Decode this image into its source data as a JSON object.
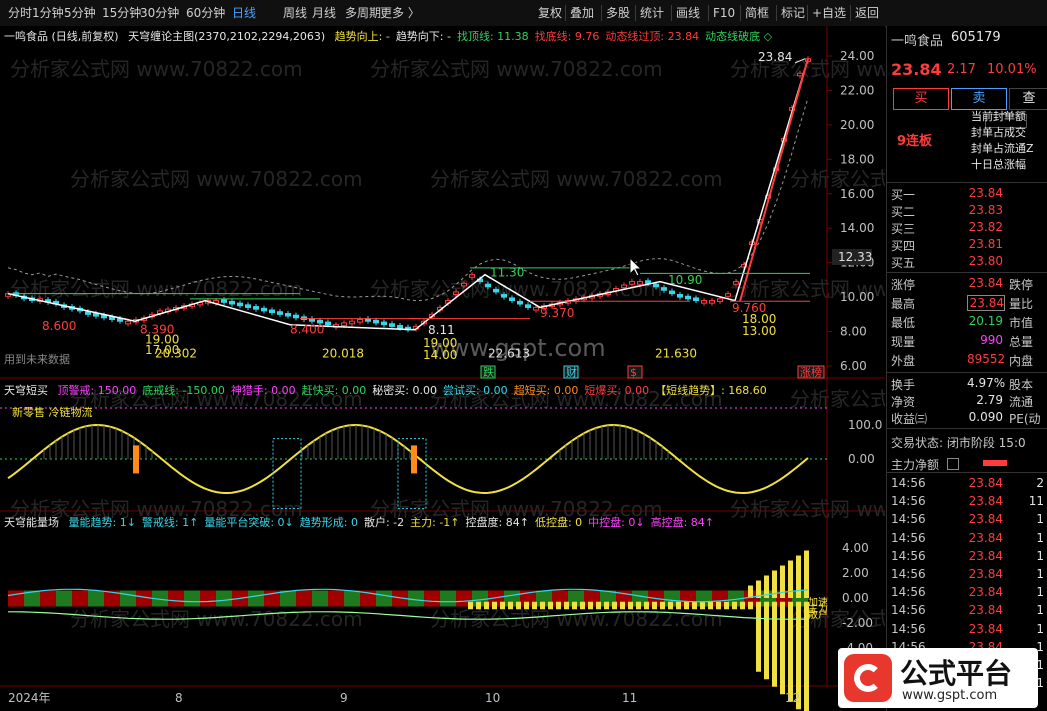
{
  "toolbar": {
    "periods": [
      "分时",
      "1分钟",
      "5分钟",
      "15分钟",
      "30分钟",
      "60分钟",
      "日线",
      "周线",
      "月线",
      "多周期",
      "更多 〉"
    ],
    "active_period": "日线",
    "tools": [
      "复权",
      "叠加",
      "多股",
      "统计",
      "画线",
      "F10",
      "简框",
      "标记",
      "+自选",
      "返回"
    ]
  },
  "main_pane": {
    "stock_label": "一鸣食品 (日线,前复权)",
    "indicator_name": "天穹缠论主图(2370,2102,2294,2063)",
    "items": [
      {
        "text": "趋势向上: -",
        "color": "#f0e040"
      },
      {
        "text": "趋势向下: -",
        "color": "#e6e6e6"
      },
      {
        "text": "找顶线: 11.38",
        "color": "#2fd35b"
      },
      {
        "text": "找底线: 9.76",
        "color": "#ff3c3c"
      },
      {
        "text": "动态线过顶: 23.84",
        "color": "#ff3c3c"
      },
      {
        "text": "动态线破底 ◇",
        "color": "#2fd35b"
      }
    ],
    "y_ticks": [
      "24.00",
      "22.00",
      "20.00",
      "18.00",
      "16.00",
      "14.00",
      "12.00",
      "10.00",
      "8.00",
      "6.00"
    ],
    "current_price_tag": "12.33",
    "annotations": {
      "high_label": "23.84",
      "low_labels": [
        "8.600",
        "8.390",
        "8.400",
        "8.11",
        "9.370",
        "9.760"
      ],
      "top_labels": [
        "11.30",
        "10.90"
      ],
      "lines": [
        "19.00",
        "17.00",
        "19.00",
        "14.00",
        "18.00",
        "13.00"
      ],
      "bottom_values": [
        "20.302",
        "20.018",
        "22.613",
        "21.630"
      ],
      "future_text": "用到未来数据",
      "markers": [
        "跌",
        "财",
        "$",
        "涨榜"
      ],
      "watermark_site": "www.gspt.com",
      "watermark_text": "分析家公式网 www.70822.com"
    }
  },
  "short_pane": {
    "title": "天穹短买",
    "items": [
      {
        "text": "顶警戒: 150.00",
        "color": "#ff40ff"
      },
      {
        "text": "底戒线: -150.00",
        "color": "#2fd35b"
      },
      {
        "text": "神猎手: 0.00",
        "color": "#ff40ff"
      },
      {
        "text": "赶快买: 0.00",
        "color": "#2fd35b"
      },
      {
        "text": "秘密买: 0.00",
        "color": "#e6e6e6"
      },
      {
        "text": "尝试买: 0.00",
        "color": "#39d5e8"
      },
      {
        "text": "超短买: 0.00",
        "color": "#ff8c1a"
      },
      {
        "text": "短爆买: 0.00",
        "color": "#ff3c3c"
      },
      {
        "text": "【短线趋势】: 168.60",
        "color": "#f0e040"
      }
    ],
    "sub_label": "新零售 冷链物流",
    "y_ticks": [
      "100.0",
      "0.00"
    ]
  },
  "volume_pane": {
    "title": "天穹能量场",
    "items": [
      {
        "text": "量能趋势: 1↓",
        "color": "#39d5e8"
      },
      {
        "text": "警戒线: 1↑",
        "color": "#39d5e8"
      },
      {
        "text": "量能平台突破: 0↓",
        "color": "#39d5e8"
      },
      {
        "text": "趋势形成: 0",
        "color": "#39d5e8"
      },
      {
        "text": "散户: -2",
        "color": "#e6e6e6"
      },
      {
        "text": "主力: -1↑",
        "color": "#f0e040"
      },
      {
        "text": "控盘度: 84↑",
        "color": "#e6e6e6"
      },
      {
        "text": "低控盘: 0",
        "color": "#f0e040"
      },
      {
        "text": "中控盘: 0↓",
        "color": "#ff40ff"
      },
      {
        "text": "高控盘: 84↑",
        "color": "#ff40ff"
      }
    ],
    "y_ticks": [
      "4.00",
      "2.00",
      "0.00",
      "-2.00",
      "-4.00"
    ],
    "right_tags": [
      "加速",
      "主力",
      "散户"
    ]
  },
  "x_axis": {
    "labels": [
      "2024年",
      "8",
      "9",
      "10",
      "11",
      "12"
    ]
  },
  "panel": {
    "stock_name": "一鸣食品",
    "stock_code": "605179",
    "price": "23.84",
    "change": "2.17",
    "change_pct": "10.01%",
    "buy_label": "买",
    "sell_label": "卖",
    "more_label": "查",
    "limit_badge": "9连板",
    "limit_info": [
      "当前封单额",
      "封单占成交",
      "封单占流通Z",
      "十日总涨幅"
    ],
    "bids": [
      {
        "label": "买一",
        "price": "23.84"
      },
      {
        "label": "买二",
        "price": "23.83"
      },
      {
        "label": "买三",
        "price": "23.82"
      },
      {
        "label": "买四",
        "price": "23.81"
      },
      {
        "label": "买五",
        "price": "23.80"
      }
    ],
    "stats": [
      {
        "l": "涨停",
        "v": "23.84",
        "vc": "#ff3c3c",
        "r": "跌停"
      },
      {
        "l": "最高",
        "v": "23.84",
        "vc": "#ff3c3c",
        "r": "量比"
      },
      {
        "l": "最低",
        "v": "20.19",
        "vc": "#2fd35b",
        "r": "市值"
      },
      {
        "l": "现量",
        "v": "990",
        "vc": "#ff40ff",
        "r": "总量"
      },
      {
        "l": "外盘",
        "v": "89552",
        "vc": "#ff3c3c",
        "r": "内盘"
      }
    ],
    "stats2": [
      {
        "l": "换手",
        "v": "4.97%",
        "r": "股本"
      },
      {
        "l": "净资",
        "v": "2.79",
        "r": "流通"
      },
      {
        "l": "收益㈢",
        "v": "0.090",
        "r": "PE(动"
      }
    ],
    "trade_status": "交易状态: 闭市阶段 15:0",
    "main_flow_label": "主力净额",
    "ticks": [
      {
        "t": "14:56",
        "p": "23.84",
        "v": "2"
      },
      {
        "t": "14:56",
        "p": "23.84",
        "v": "11"
      },
      {
        "t": "14:56",
        "p": "23.84",
        "v": "1"
      },
      {
        "t": "14:56",
        "p": "23.84",
        "v": "1"
      },
      {
        "t": "14:56",
        "p": "23.84",
        "v": "1"
      },
      {
        "t": "14:56",
        "p": "23.84",
        "v": "1"
      },
      {
        "t": "14:56",
        "p": "23.84",
        "v": "1"
      },
      {
        "t": "14:56",
        "p": "23.84",
        "v": "1"
      },
      {
        "t": "14:56",
        "p": "23.84",
        "v": "1"
      },
      {
        "t": "14:56",
        "p": "23.84",
        "v": "1"
      },
      {
        "t": "14:56",
        "p": "23.84",
        "v": "1"
      },
      {
        "t": "14:56",
        "p": "23.84",
        "v": "1"
      }
    ]
  },
  "logo": {
    "text": "公式平台",
    "site": "www.gspt.com"
  }
}
